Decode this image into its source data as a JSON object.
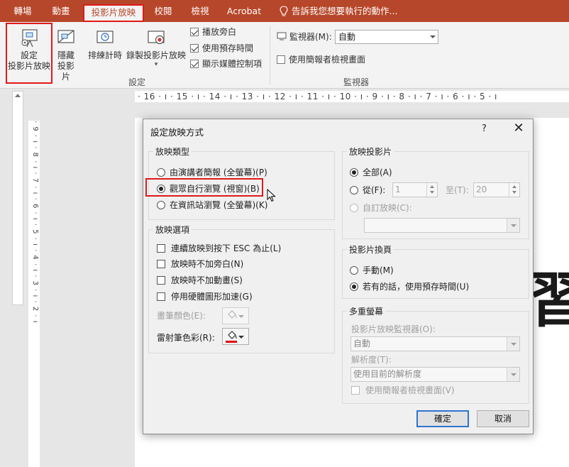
{
  "ribbon_tabs": [
    {
      "label": "轉場"
    },
    {
      "label": "動畫"
    },
    {
      "label": "投影片放映"
    },
    {
      "label": "校閱"
    },
    {
      "label": "檢視"
    },
    {
      "label": "Acrobat"
    },
    {
      "label": "告訴我您想要執行的動作..."
    }
  ],
  "ribbon": {
    "setup_show": {
      "line1": "設定",
      "line2": "投影片放映"
    },
    "hide_slide": {
      "line1": "隱藏",
      "line2": "投影片"
    },
    "rehearse": {
      "label": "排練計時"
    },
    "record": {
      "label": "錄製投影片放映"
    },
    "checkboxes": [
      {
        "label": "播放旁白",
        "checked": true
      },
      {
        "label": "使用預存時間",
        "checked": true
      },
      {
        "label": "顯示媒體控制項",
        "checked": true
      }
    ],
    "setup_group_label": "設定",
    "monitor_label": "監視器(M):",
    "monitor_value": "自動",
    "presenter_view_label": "使用簡報者檢視畫面",
    "monitors_group_label": "監視器"
  },
  "ruler": {
    "horizontal": "· 16 · ı · 15 · ı · 14 · ı · 13 · ı · 12 · ı · 11 · ı · 10 · ı · 9 · ı · 8 · ı · 7 · ı · 6 · ı · 5 · ı",
    "vertical": "· 9 · ı · 8 · ı · 7 · ı · 6 · ı · 5 · ı · 4 · ı · 3 · ı · 2 · ı"
  },
  "slide_glyph": "習",
  "dialog": {
    "title": "設定放映方式",
    "help": "?",
    "close": "✕",
    "show_type": {
      "legend": "放映類型",
      "options": [
        {
          "label": "由演講者簡報 (全螢幕)(P)",
          "selected": false
        },
        {
          "label": "觀眾自行瀏覽 (視窗)(B)",
          "selected": true
        },
        {
          "label": "在資訊站瀏覽 (全螢幕)(K)",
          "selected": false
        }
      ]
    },
    "show_options": {
      "legend": "放映選項",
      "items": [
        {
          "label": "連續放映到按下 ESC 為止(L)"
        },
        {
          "label": "放映時不加旁白(N)"
        },
        {
          "label": "放映時不加動畫(S)"
        },
        {
          "label": "停用硬體圖形加速(G)"
        }
      ],
      "pen_color_label": "畫筆顏色(E):",
      "laser_color_label": "雷射筆色彩(R):",
      "laser_color": "#e01010"
    },
    "show_slides": {
      "legend": "放映投影片",
      "all_label": "全部(A)",
      "from_label": "從(F):",
      "from_value": "1",
      "to_label": "至(T):",
      "to_value": "20",
      "custom_label": "自訂放映(C):"
    },
    "advance": {
      "legend": "投影片換頁",
      "manual_label": "手動(M)",
      "timings_label": "若有的話，使用預存時間(U)"
    },
    "multi_monitor": {
      "legend": "多重螢幕",
      "monitor_label": "投影片放映監視器(O):",
      "monitor_value": "自動",
      "resolution_label": "解析度(T):",
      "resolution_value": "使用目前的解析度",
      "presenter_label": "使用簡報者檢視畫面(V)"
    },
    "ok_label": "確定",
    "cancel_label": "取消"
  }
}
